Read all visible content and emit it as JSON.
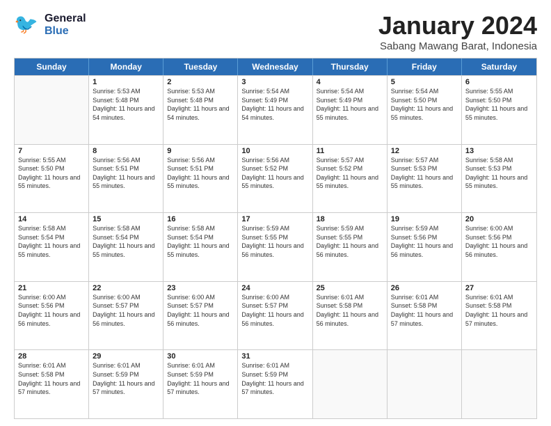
{
  "header": {
    "logo_general": "General",
    "logo_blue": "Blue",
    "month_title": "January 2024",
    "subtitle": "Sabang Mawang Barat, Indonesia"
  },
  "calendar": {
    "days_of_week": [
      "Sunday",
      "Monday",
      "Tuesday",
      "Wednesday",
      "Thursday",
      "Friday",
      "Saturday"
    ],
    "weeks": [
      [
        {
          "day": "",
          "empty": true
        },
        {
          "day": "1",
          "sunrise": "Sunrise: 5:53 AM",
          "sunset": "Sunset: 5:48 PM",
          "daylight": "Daylight: 11 hours and 54 minutes."
        },
        {
          "day": "2",
          "sunrise": "Sunrise: 5:53 AM",
          "sunset": "Sunset: 5:48 PM",
          "daylight": "Daylight: 11 hours and 54 minutes."
        },
        {
          "day": "3",
          "sunrise": "Sunrise: 5:54 AM",
          "sunset": "Sunset: 5:49 PM",
          "daylight": "Daylight: 11 hours and 54 minutes."
        },
        {
          "day": "4",
          "sunrise": "Sunrise: 5:54 AM",
          "sunset": "Sunset: 5:49 PM",
          "daylight": "Daylight: 11 hours and 55 minutes."
        },
        {
          "day": "5",
          "sunrise": "Sunrise: 5:54 AM",
          "sunset": "Sunset: 5:50 PM",
          "daylight": "Daylight: 11 hours and 55 minutes."
        },
        {
          "day": "6",
          "sunrise": "Sunrise: 5:55 AM",
          "sunset": "Sunset: 5:50 PM",
          "daylight": "Daylight: 11 hours and 55 minutes."
        }
      ],
      [
        {
          "day": "7",
          "sunrise": "Sunrise: 5:55 AM",
          "sunset": "Sunset: 5:50 PM",
          "daylight": "Daylight: 11 hours and 55 minutes."
        },
        {
          "day": "8",
          "sunrise": "Sunrise: 5:56 AM",
          "sunset": "Sunset: 5:51 PM",
          "daylight": "Daylight: 11 hours and 55 minutes."
        },
        {
          "day": "9",
          "sunrise": "Sunrise: 5:56 AM",
          "sunset": "Sunset: 5:51 PM",
          "daylight": "Daylight: 11 hours and 55 minutes."
        },
        {
          "day": "10",
          "sunrise": "Sunrise: 5:56 AM",
          "sunset": "Sunset: 5:52 PM",
          "daylight": "Daylight: 11 hours and 55 minutes."
        },
        {
          "day": "11",
          "sunrise": "Sunrise: 5:57 AM",
          "sunset": "Sunset: 5:52 PM",
          "daylight": "Daylight: 11 hours and 55 minutes."
        },
        {
          "day": "12",
          "sunrise": "Sunrise: 5:57 AM",
          "sunset": "Sunset: 5:53 PM",
          "daylight": "Daylight: 11 hours and 55 minutes."
        },
        {
          "day": "13",
          "sunrise": "Sunrise: 5:58 AM",
          "sunset": "Sunset: 5:53 PM",
          "daylight": "Daylight: 11 hours and 55 minutes."
        }
      ],
      [
        {
          "day": "14",
          "sunrise": "Sunrise: 5:58 AM",
          "sunset": "Sunset: 5:54 PM",
          "daylight": "Daylight: 11 hours and 55 minutes."
        },
        {
          "day": "15",
          "sunrise": "Sunrise: 5:58 AM",
          "sunset": "Sunset: 5:54 PM",
          "daylight": "Daylight: 11 hours and 55 minutes."
        },
        {
          "day": "16",
          "sunrise": "Sunrise: 5:58 AM",
          "sunset": "Sunset: 5:54 PM",
          "daylight": "Daylight: 11 hours and 55 minutes."
        },
        {
          "day": "17",
          "sunrise": "Sunrise: 5:59 AM",
          "sunset": "Sunset: 5:55 PM",
          "daylight": "Daylight: 11 hours and 56 minutes."
        },
        {
          "day": "18",
          "sunrise": "Sunrise: 5:59 AM",
          "sunset": "Sunset: 5:55 PM",
          "daylight": "Daylight: 11 hours and 56 minutes."
        },
        {
          "day": "19",
          "sunrise": "Sunrise: 5:59 AM",
          "sunset": "Sunset: 5:56 PM",
          "daylight": "Daylight: 11 hours and 56 minutes."
        },
        {
          "day": "20",
          "sunrise": "Sunrise: 6:00 AM",
          "sunset": "Sunset: 5:56 PM",
          "daylight": "Daylight: 11 hours and 56 minutes."
        }
      ],
      [
        {
          "day": "21",
          "sunrise": "Sunrise: 6:00 AM",
          "sunset": "Sunset: 5:56 PM",
          "daylight": "Daylight: 11 hours and 56 minutes."
        },
        {
          "day": "22",
          "sunrise": "Sunrise: 6:00 AM",
          "sunset": "Sunset: 5:57 PM",
          "daylight": "Daylight: 11 hours and 56 minutes."
        },
        {
          "day": "23",
          "sunrise": "Sunrise: 6:00 AM",
          "sunset": "Sunset: 5:57 PM",
          "daylight": "Daylight: 11 hours and 56 minutes."
        },
        {
          "day": "24",
          "sunrise": "Sunrise: 6:00 AM",
          "sunset": "Sunset: 5:57 PM",
          "daylight": "Daylight: 11 hours and 56 minutes."
        },
        {
          "day": "25",
          "sunrise": "Sunrise: 6:01 AM",
          "sunset": "Sunset: 5:58 PM",
          "daylight": "Daylight: 11 hours and 56 minutes."
        },
        {
          "day": "26",
          "sunrise": "Sunrise: 6:01 AM",
          "sunset": "Sunset: 5:58 PM",
          "daylight": "Daylight: 11 hours and 57 minutes."
        },
        {
          "day": "27",
          "sunrise": "Sunrise: 6:01 AM",
          "sunset": "Sunset: 5:58 PM",
          "daylight": "Daylight: 11 hours and 57 minutes."
        }
      ],
      [
        {
          "day": "28",
          "sunrise": "Sunrise: 6:01 AM",
          "sunset": "Sunset: 5:58 PM",
          "daylight": "Daylight: 11 hours and 57 minutes."
        },
        {
          "day": "29",
          "sunrise": "Sunrise: 6:01 AM",
          "sunset": "Sunset: 5:59 PM",
          "daylight": "Daylight: 11 hours and 57 minutes."
        },
        {
          "day": "30",
          "sunrise": "Sunrise: 6:01 AM",
          "sunset": "Sunset: 5:59 PM",
          "daylight": "Daylight: 11 hours and 57 minutes."
        },
        {
          "day": "31",
          "sunrise": "Sunrise: 6:01 AM",
          "sunset": "Sunset: 5:59 PM",
          "daylight": "Daylight: 11 hours and 57 minutes."
        },
        {
          "day": "",
          "empty": true
        },
        {
          "day": "",
          "empty": true
        },
        {
          "day": "",
          "empty": true
        }
      ]
    ]
  }
}
